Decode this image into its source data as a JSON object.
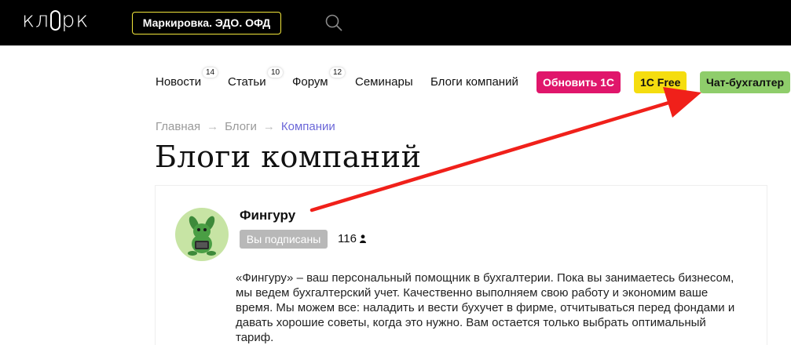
{
  "header": {
    "logo": "кл⊂рк",
    "logo_parts": {
      "left": "кл",
      "right": "рк"
    },
    "promo_button": "Маркировка. ЭДО. ОФД"
  },
  "nav": {
    "items": [
      {
        "label": "Новости",
        "badge": "14"
      },
      {
        "label": "Статьи",
        "badge": "10"
      },
      {
        "label": "Форум",
        "badge": "12"
      },
      {
        "label": "Семинары",
        "badge": ""
      },
      {
        "label": "Блоги компаний",
        "badge": ""
      }
    ],
    "pills": {
      "update": "Обновить 1С",
      "free": "1С Free",
      "chat": "Чат-бухгалтер"
    }
  },
  "breadcrumbs": {
    "home": "Главная",
    "blogs": "Блоги",
    "current": "Компании",
    "separator": "→"
  },
  "page_title": "Блоги компаний",
  "blog": {
    "name": "Фингуру",
    "subscribed_label": "Вы подписаны",
    "subscribers": "116",
    "description_lines": [
      "«Фингуру» – ваш персональный помощник в бухгалтерии. Пока вы занимаетесь бизнесом,",
      "мы ведем бухгалтерский учет. Качественно выполняем свою работу и экономим ваше",
      "время. Мы можем все: наладить и вести бухучет в фирме, отчитываться перед фондами и",
      "давать хорошие советы, когда это нужно. Вам остается только выбрать оптимальный",
      "тариф."
    ]
  },
  "colors": {
    "accent_pink": "#e0166b",
    "accent_yellow": "#f5dd0f",
    "accent_green": "#8fcd6b",
    "breadcrumb_active": "#6c68d8",
    "annotation_arrow": "#f0201a"
  }
}
